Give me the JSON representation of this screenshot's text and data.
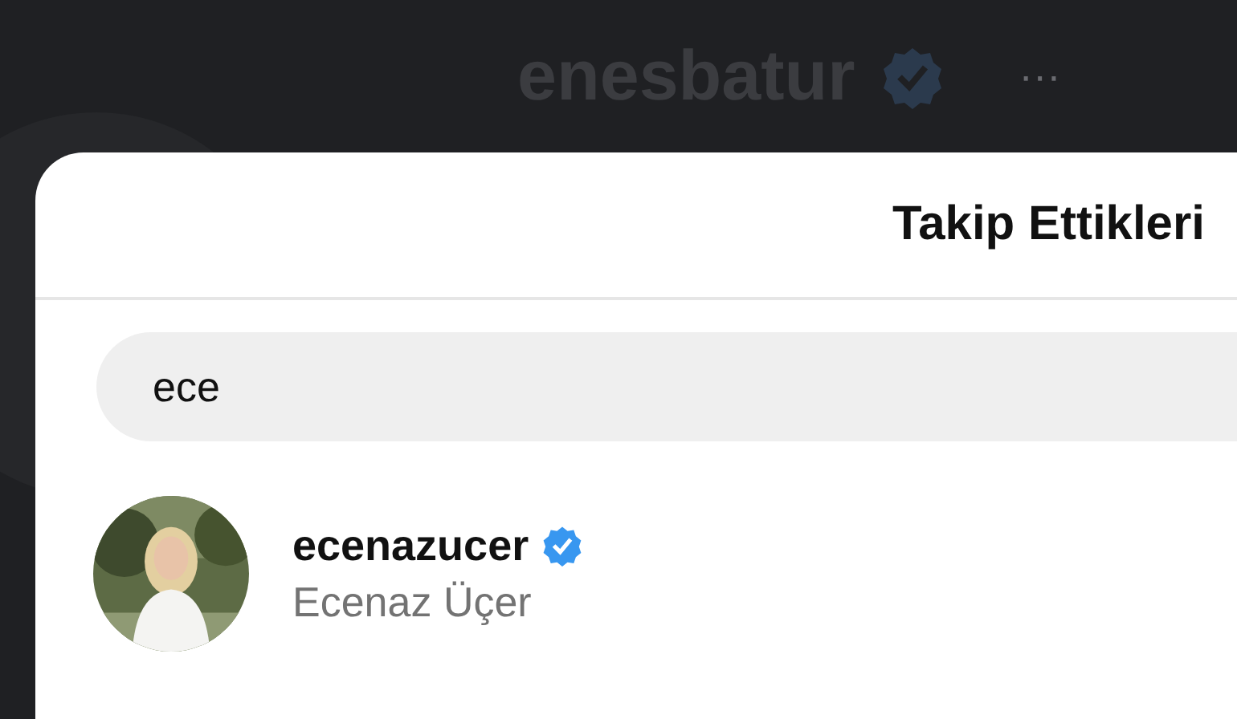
{
  "profile_header": {
    "username": "enesbatur",
    "verified": true,
    "menu": "···"
  },
  "modal": {
    "title": "Takip Ettikleri",
    "search": {
      "value": "ece"
    },
    "results": [
      {
        "username": "ecenazucer",
        "full_name": "Ecenaz Üçer",
        "verified": true
      }
    ]
  }
}
